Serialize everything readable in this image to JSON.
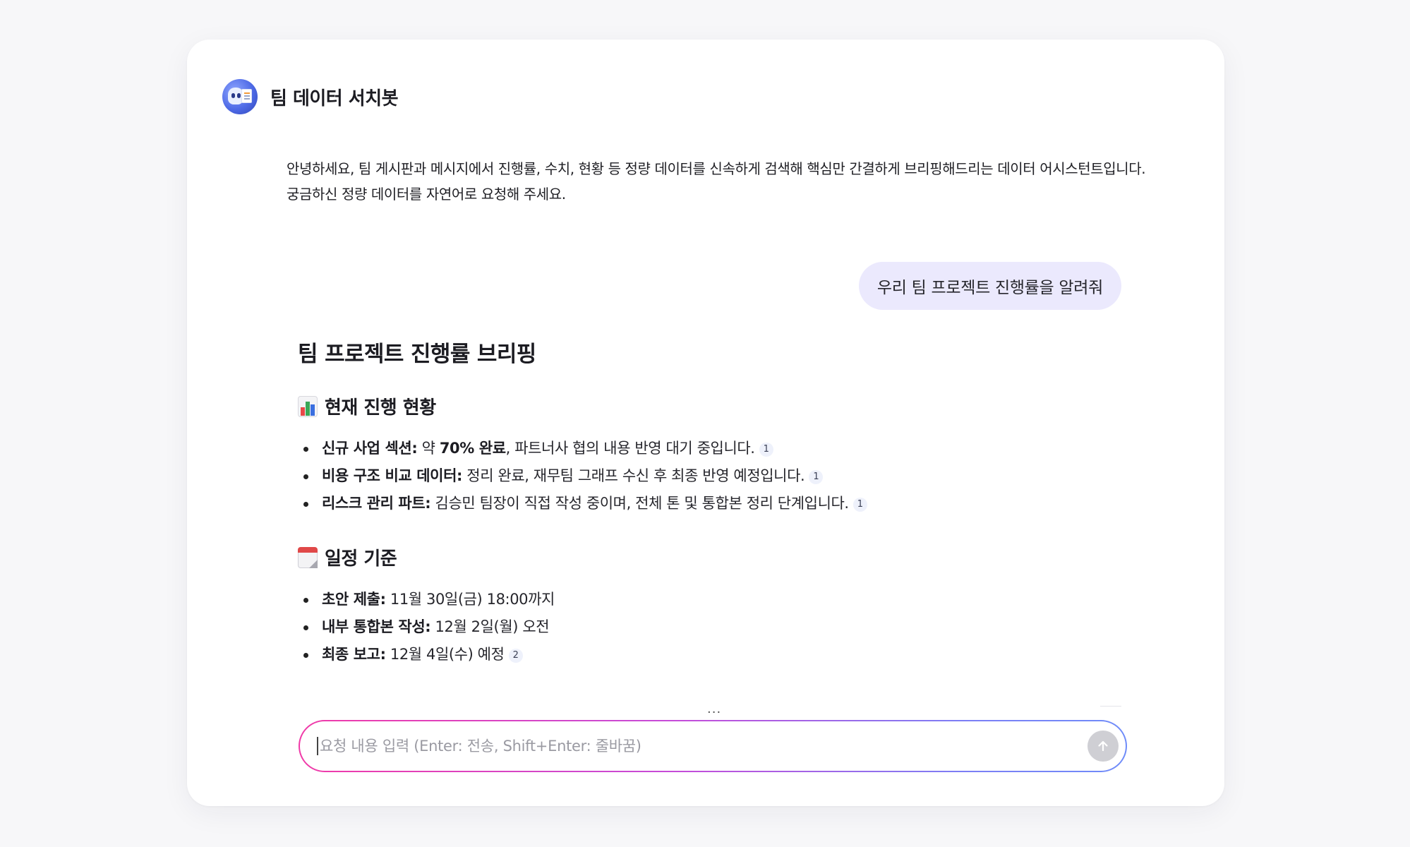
{
  "bot": {
    "name": "팀 데이터 서치봇",
    "intro_line1": "안녕하세요, 팀 게시판과 메시지에서 진행률, 수치, 현황 등 정량 데이터를 신속하게 검색해 핵심만 간결하게 브리핑해드리는 데이터 어시스턴트입니다.",
    "intro_line2": "궁금하신 정량 데이터를 자연어로 요청해 주세요."
  },
  "user_message": "우리 팀 프로젝트 진행률을 알려줘",
  "answer": {
    "title": "팀 프로젝트 진행률 브리핑",
    "section1": {
      "icon": "bar-chart-icon",
      "heading": "현재 진행 현황",
      "items": [
        {
          "label": "신규 사업 섹션:",
          "pre": " 약 ",
          "bold": "70% 완료",
          "post": ", 파트너사 협의 내용 반영 대기 중입니다.",
          "cite": "1"
        },
        {
          "label": "비용 구조 비교 데이터:",
          "text": " 정리 완료, 재무팀 그래프 수신 후 최종 반영 예정입니다.",
          "cite": "1"
        },
        {
          "label": "리스크 관리 파트:",
          "text": " 김승민 팀장이 직접 작성 중이며, 전체 톤 및 통합본 정리 단계입니다.",
          "cite": "1"
        }
      ]
    },
    "section2": {
      "icon": "calendar-icon",
      "heading": "일정 기준",
      "items": [
        {
          "label": "초안 제출:",
          "text": " 11월 30일(금) 18:00까지"
        },
        {
          "label": "내부 통합본 작성:",
          "text": " 12월 2일(월) 오전"
        },
        {
          "label": "최종 보고:",
          "text": " 12월 4일(수) 예정",
          "cite": "2"
        }
      ]
    }
  },
  "more_indicator": "...",
  "composer": {
    "placeholder": "요청 내용 입력 (Enter: 전송, Shift+Enter: 줄바꿈)",
    "send_icon": "arrow-up-icon"
  },
  "colors": {
    "user_bubble": "#ebe9fd",
    "input_gradient_start": "#f03aa8",
    "input_gradient_end": "#6f8cf9",
    "send_button": "#cfcfd4"
  }
}
